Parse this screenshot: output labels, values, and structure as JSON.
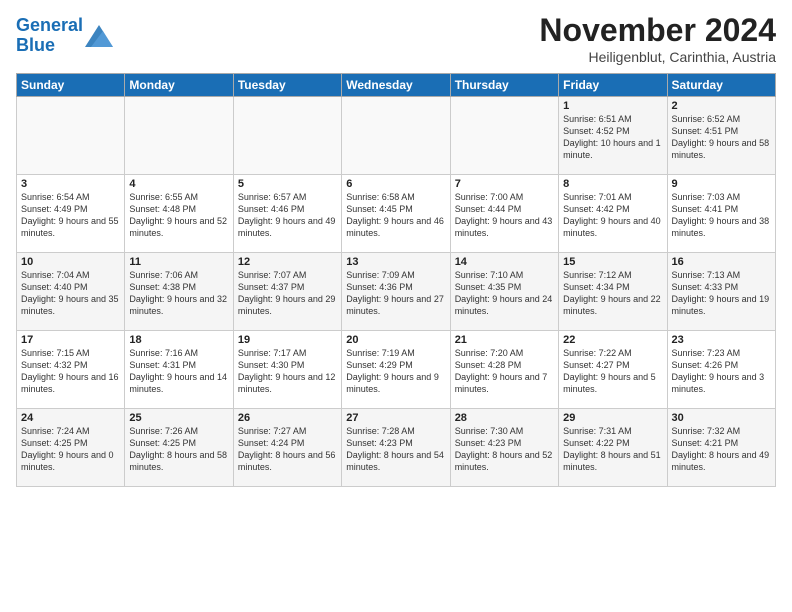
{
  "logo": {
    "line1": "General",
    "line2": "Blue"
  },
  "header": {
    "title": "November 2024",
    "subtitle": "Heiligenblut, Carinthia, Austria"
  },
  "weekdays": [
    "Sunday",
    "Monday",
    "Tuesday",
    "Wednesday",
    "Thursday",
    "Friday",
    "Saturday"
  ],
  "weeks": [
    [
      {
        "day": "",
        "info": ""
      },
      {
        "day": "",
        "info": ""
      },
      {
        "day": "",
        "info": ""
      },
      {
        "day": "",
        "info": ""
      },
      {
        "day": "",
        "info": ""
      },
      {
        "day": "1",
        "info": "Sunrise: 6:51 AM\nSunset: 4:52 PM\nDaylight: 10 hours and 1 minute."
      },
      {
        "day": "2",
        "info": "Sunrise: 6:52 AM\nSunset: 4:51 PM\nDaylight: 9 hours and 58 minutes."
      }
    ],
    [
      {
        "day": "3",
        "info": "Sunrise: 6:54 AM\nSunset: 4:49 PM\nDaylight: 9 hours and 55 minutes."
      },
      {
        "day": "4",
        "info": "Sunrise: 6:55 AM\nSunset: 4:48 PM\nDaylight: 9 hours and 52 minutes."
      },
      {
        "day": "5",
        "info": "Sunrise: 6:57 AM\nSunset: 4:46 PM\nDaylight: 9 hours and 49 minutes."
      },
      {
        "day": "6",
        "info": "Sunrise: 6:58 AM\nSunset: 4:45 PM\nDaylight: 9 hours and 46 minutes."
      },
      {
        "day": "7",
        "info": "Sunrise: 7:00 AM\nSunset: 4:44 PM\nDaylight: 9 hours and 43 minutes."
      },
      {
        "day": "8",
        "info": "Sunrise: 7:01 AM\nSunset: 4:42 PM\nDaylight: 9 hours and 40 minutes."
      },
      {
        "day": "9",
        "info": "Sunrise: 7:03 AM\nSunset: 4:41 PM\nDaylight: 9 hours and 38 minutes."
      }
    ],
    [
      {
        "day": "10",
        "info": "Sunrise: 7:04 AM\nSunset: 4:40 PM\nDaylight: 9 hours and 35 minutes."
      },
      {
        "day": "11",
        "info": "Sunrise: 7:06 AM\nSunset: 4:38 PM\nDaylight: 9 hours and 32 minutes."
      },
      {
        "day": "12",
        "info": "Sunrise: 7:07 AM\nSunset: 4:37 PM\nDaylight: 9 hours and 29 minutes."
      },
      {
        "day": "13",
        "info": "Sunrise: 7:09 AM\nSunset: 4:36 PM\nDaylight: 9 hours and 27 minutes."
      },
      {
        "day": "14",
        "info": "Sunrise: 7:10 AM\nSunset: 4:35 PM\nDaylight: 9 hours and 24 minutes."
      },
      {
        "day": "15",
        "info": "Sunrise: 7:12 AM\nSunset: 4:34 PM\nDaylight: 9 hours and 22 minutes."
      },
      {
        "day": "16",
        "info": "Sunrise: 7:13 AM\nSunset: 4:33 PM\nDaylight: 9 hours and 19 minutes."
      }
    ],
    [
      {
        "day": "17",
        "info": "Sunrise: 7:15 AM\nSunset: 4:32 PM\nDaylight: 9 hours and 16 minutes."
      },
      {
        "day": "18",
        "info": "Sunrise: 7:16 AM\nSunset: 4:31 PM\nDaylight: 9 hours and 14 minutes."
      },
      {
        "day": "19",
        "info": "Sunrise: 7:17 AM\nSunset: 4:30 PM\nDaylight: 9 hours and 12 minutes."
      },
      {
        "day": "20",
        "info": "Sunrise: 7:19 AM\nSunset: 4:29 PM\nDaylight: 9 hours and 9 minutes."
      },
      {
        "day": "21",
        "info": "Sunrise: 7:20 AM\nSunset: 4:28 PM\nDaylight: 9 hours and 7 minutes."
      },
      {
        "day": "22",
        "info": "Sunrise: 7:22 AM\nSunset: 4:27 PM\nDaylight: 9 hours and 5 minutes."
      },
      {
        "day": "23",
        "info": "Sunrise: 7:23 AM\nSunset: 4:26 PM\nDaylight: 9 hours and 3 minutes."
      }
    ],
    [
      {
        "day": "24",
        "info": "Sunrise: 7:24 AM\nSunset: 4:25 PM\nDaylight: 9 hours and 0 minutes."
      },
      {
        "day": "25",
        "info": "Sunrise: 7:26 AM\nSunset: 4:25 PM\nDaylight: 8 hours and 58 minutes."
      },
      {
        "day": "26",
        "info": "Sunrise: 7:27 AM\nSunset: 4:24 PM\nDaylight: 8 hours and 56 minutes."
      },
      {
        "day": "27",
        "info": "Sunrise: 7:28 AM\nSunset: 4:23 PM\nDaylight: 8 hours and 54 minutes."
      },
      {
        "day": "28",
        "info": "Sunrise: 7:30 AM\nSunset: 4:23 PM\nDaylight: 8 hours and 52 minutes."
      },
      {
        "day": "29",
        "info": "Sunrise: 7:31 AM\nSunset: 4:22 PM\nDaylight: 8 hours and 51 minutes."
      },
      {
        "day": "30",
        "info": "Sunrise: 7:32 AM\nSunset: 4:21 PM\nDaylight: 8 hours and 49 minutes."
      }
    ]
  ]
}
